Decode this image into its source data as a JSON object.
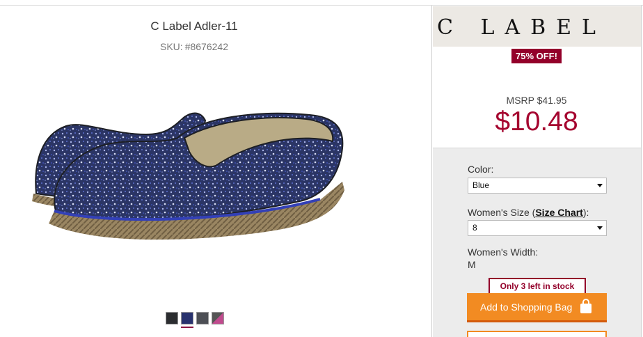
{
  "product": {
    "title": "C Label Adler-11",
    "sku_label": "SKU:",
    "sku": "#8676242",
    "image_icon": "espadrille-shoe-image",
    "swatch_colors": [
      "#2b2d30",
      "#28326e",
      "#4d4f55",
      "#c04b8e"
    ],
    "selected_swatch_index": 1
  },
  "brand": {
    "logo_text": "C LABEL"
  },
  "pricing": {
    "discount": "75% OFF!",
    "msrp": "MSRP $41.95",
    "price": "$10.48"
  },
  "options": {
    "color_label": "Color:",
    "color_value": "Blue",
    "size_label_prefix": "Women's Size (",
    "size_chart": "Size Chart",
    "size_label_suffix": "):",
    "size_value": "8",
    "width_label": "Women's Width:",
    "width_value": "M"
  },
  "stock": "Only 3 left in stock",
  "cart": {
    "add_label": "Add to Shopping Bag",
    "icon": "shopping-bag-icon"
  },
  "colors": {
    "accent": "#93002a",
    "price": "#a5052f",
    "button": "#f28b22"
  }
}
